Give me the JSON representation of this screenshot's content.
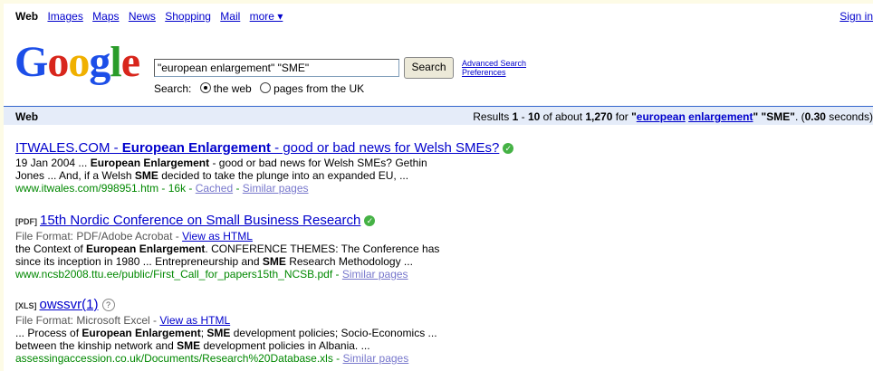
{
  "nav": {
    "active": "Web",
    "links": [
      "Images",
      "Maps",
      "News",
      "Shopping",
      "Mail"
    ],
    "more": "more ▾",
    "sign_in": "Sign in"
  },
  "logo": {
    "letters": [
      "G",
      "o",
      "o",
      "g",
      "l",
      "e"
    ]
  },
  "search": {
    "value": "\"european enlargement\" \"SME\"",
    "button": "Search",
    "advanced": "Advanced Search",
    "preferences": "Preferences",
    "scope_label": "Search:",
    "scope_web": "the web",
    "scope_uk": "pages from the UK"
  },
  "results_bar": {
    "label": "Web",
    "prefix": "Results",
    "start": "1",
    "dash": " - ",
    "end": "10",
    "of_about": " of about ",
    "total": "1,270",
    "for": " for ",
    "q1": "european",
    "q2": "enlargement",
    "q3": "\"SME\"",
    "time_prefix": ". (",
    "time": "0.30",
    "time_suffix": " seconds)"
  },
  "results": [
    {
      "title_pre": "ITWALES.COM - ",
      "title_bold": "European Enlargement",
      "title_post": " - good or bad news for Welsh SMEs?",
      "snippet_1a": "19 Jan 2004 ... ",
      "snippet_1b": "European Enlargement",
      "snippet_1c": " - good or bad news for Welsh SMEs? Gethin",
      "snippet_2a": "Jones ... And, if a Welsh ",
      "snippet_2b": "SME",
      "snippet_2c": " decided to take the plunge into an expanded EU, ...",
      "url": "www.itwales.com/998951.htm - 16k - ",
      "cached": "Cached",
      "sep": " - ",
      "similar": "Similar pages"
    },
    {
      "tag": "[PDF]",
      "title": "15th Nordic Conference on Small Business Research",
      "format_label": "File Format: PDF/Adobe Acrobat - ",
      "view_html": "View as HTML",
      "snippet_1a": "the Context of ",
      "snippet_1b": "European Enlargement",
      "snippet_1c": ". CONFERENCE THEMES: The Conference has",
      "snippet_2": "since its inception in 1980 ... Entrepreneurship and ",
      "snippet_2b": "SME",
      "snippet_2c": " Research Methodology ...",
      "url": "www.ncsb2008.ttu.ee/public/First_Call_for_papers15th_NCSB.pdf - ",
      "similar": "Similar pages"
    },
    {
      "tag": "[XLS]",
      "title": "owssvr(1)",
      "format_label": "File Format: Microsoft Excel - ",
      "view_html": "View as HTML",
      "snippet_1a": "... Process of ",
      "snippet_1b": "European Enlargement",
      "snippet_1c": "; ",
      "snippet_1d": "SME",
      "snippet_1e": " development policies; Socio-Economics ...",
      "snippet_2a": "between the kinship network and ",
      "snippet_2b": "SME",
      "snippet_2c": " development policies in Albania. ...",
      "url": "assessingaccession.co.uk/Documents/Research%20Database.xls - ",
      "similar": "Similar pages"
    }
  ]
}
